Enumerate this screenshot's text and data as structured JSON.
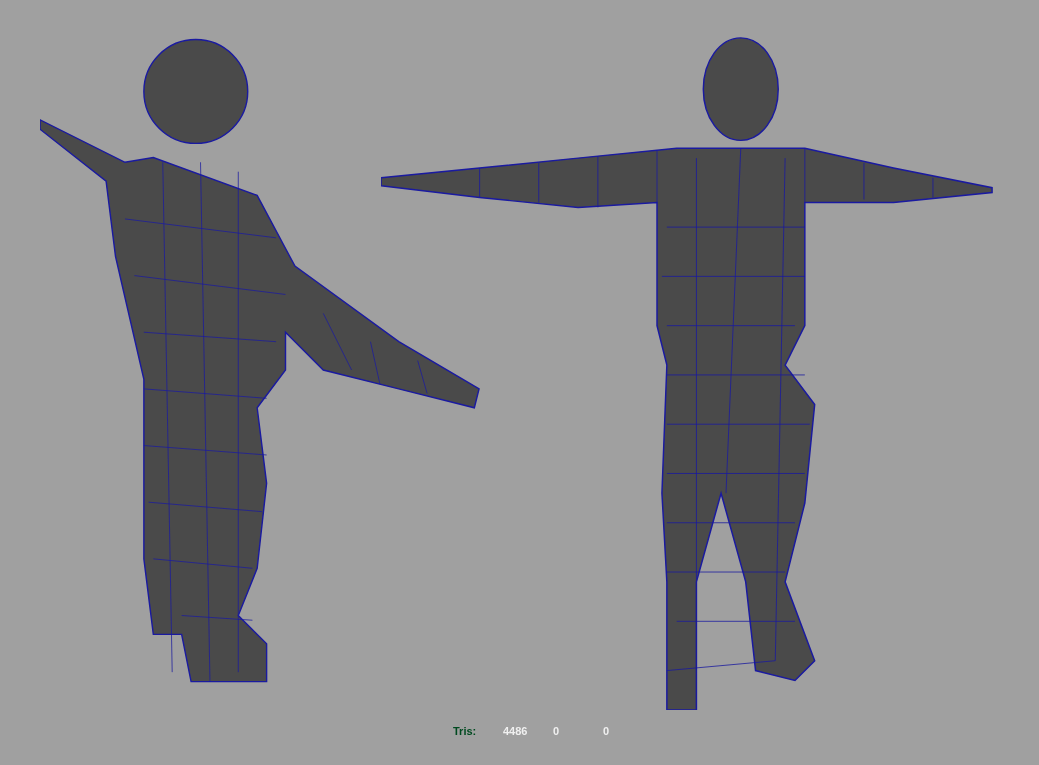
{
  "viewport": {
    "hud": {
      "label": "Tris:",
      "values": [
        "4486",
        "0",
        "0"
      ]
    }
  }
}
